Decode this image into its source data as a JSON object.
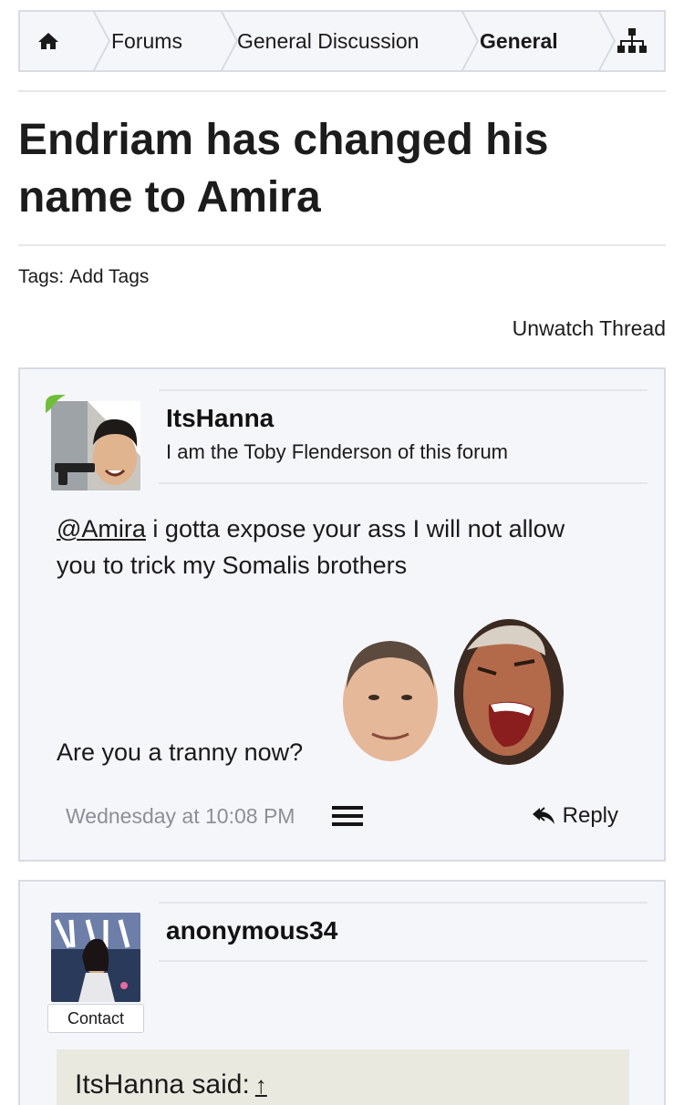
{
  "breadcrumb": {
    "items": [
      "Forums",
      "General Discussion",
      "General"
    ]
  },
  "thread": {
    "title_line1": "Endriam has changed his",
    "title_line2": "name to Amira",
    "tags_label": "Tags:",
    "add_tags": "Add Tags",
    "unwatch": "Unwatch Thread"
  },
  "posts": [
    {
      "username": "ItsHanna",
      "user_title": "I am the Toby Flenderson of this forum",
      "mention": "@Amira",
      "text_line1_rest": " i gotta expose your ass I will not allow",
      "text_line2": "you to trick my Somalis brothers",
      "text_line3": "Are you a tranny now?",
      "date": "Wednesday at 10:08 PM",
      "reply_label": "Reply"
    },
    {
      "username": "anonymous34",
      "contact_label": "Contact",
      "quote_label": "ItsHanna said:",
      "quote_arrow": "↑"
    }
  ],
  "colors": {
    "panel_bg": "#f5f6fa",
    "border": "#d8dbe2",
    "quote_bg": "#e9e9e0",
    "muted_text": "#8c8f96",
    "online_badge": "#6fbf3a"
  },
  "icons": [
    "home-icon",
    "sitemap-icon",
    "menu-icon",
    "reply-icon"
  ]
}
